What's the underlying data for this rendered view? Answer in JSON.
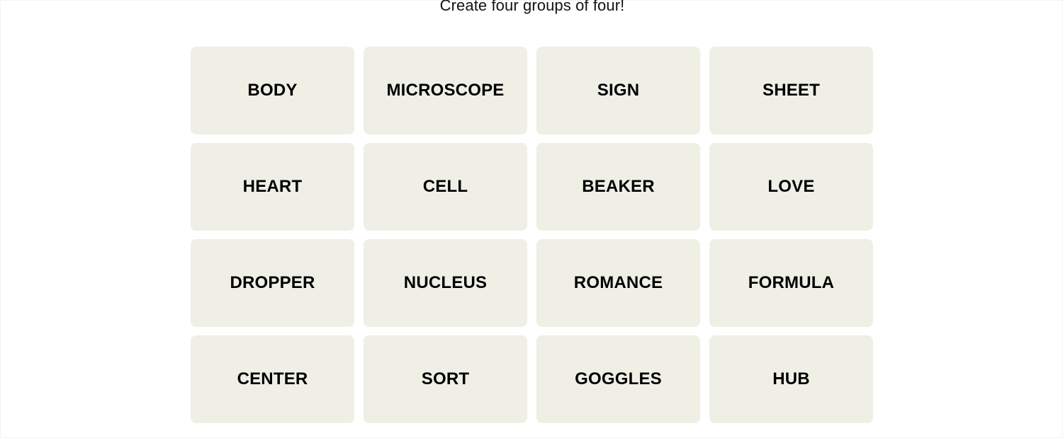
{
  "game": {
    "title": "Create four groups of four!",
    "colors": {
      "background": "#ffffff",
      "tile_background": "#efefe6",
      "tile_text": "#000000",
      "title_text": "#121212"
    },
    "grid": {
      "rows": 4,
      "columns": 4,
      "tiles": [
        {
          "label": "BODY"
        },
        {
          "label": "MICROSCOPE"
        },
        {
          "label": "SIGN"
        },
        {
          "label": "SHEET"
        },
        {
          "label": "HEART"
        },
        {
          "label": "CELL"
        },
        {
          "label": "BEAKER"
        },
        {
          "label": "LOVE"
        },
        {
          "label": "DROPPER"
        },
        {
          "label": "NUCLEUS"
        },
        {
          "label": "ROMANCE"
        },
        {
          "label": "FORMULA"
        },
        {
          "label": "CENTER"
        },
        {
          "label": "SORT"
        },
        {
          "label": "GOGGLES"
        },
        {
          "label": "HUB"
        }
      ]
    }
  }
}
